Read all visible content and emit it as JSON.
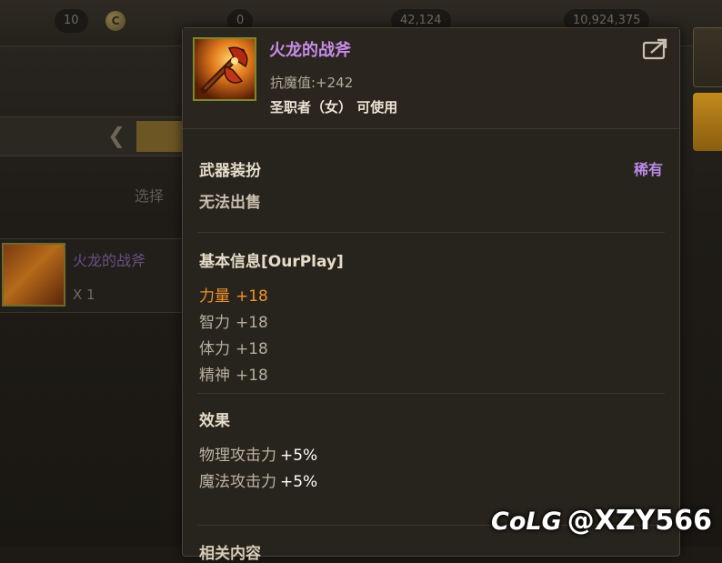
{
  "background": {
    "top_bar": {
      "val1": "10",
      "val2": "0",
      "val3": "42,124",
      "val4": "10,924,375"
    },
    "left_panel": {
      "select_hint": "选择",
      "item": {
        "name": "火龙的战斧",
        "quantity": "X 1"
      }
    }
  },
  "tooltip": {
    "item_name": "火龙的战斧",
    "magic_resist": "抗魔值:+242",
    "class_restriction": "圣职者（女） 可使用",
    "category": "武器装扮",
    "rarity": "稀有",
    "sell_status": "无法出售",
    "basic_info_title": "基本信息[OurPlay]",
    "stats": [
      {
        "name": "力量",
        "value": "+18",
        "highlight": true
      },
      {
        "name": "智力",
        "value": "+18",
        "highlight": false
      },
      {
        "name": "体力",
        "value": "+18",
        "highlight": false
      },
      {
        "name": "精神",
        "value": "+18",
        "highlight": false
      }
    ],
    "effect_title": "效果",
    "effects": [
      {
        "name": "物理攻击力",
        "value": "+5%"
      },
      {
        "name": "魔法攻击力",
        "value": "+5%"
      }
    ],
    "related_title": "相关内容"
  },
  "watermark": {
    "logo": "CoLG",
    "handle": "@XZY566"
  },
  "colors": {
    "rarity_purple": "#b98be6",
    "title_purple": "#c78ce8",
    "highlight_orange": "#f0922c"
  },
  "icons": [
    "share-icon",
    "back-arrow-icon",
    "currency-icon",
    "axe-item-icon"
  ]
}
